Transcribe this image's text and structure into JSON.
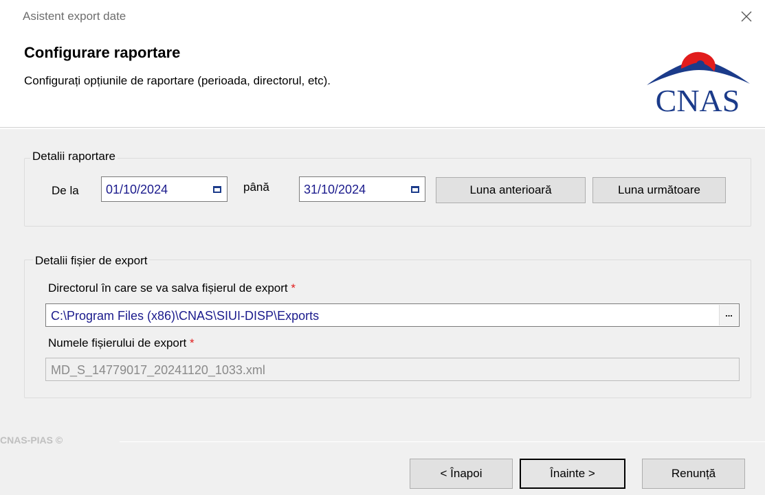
{
  "window": {
    "title": "Asistent export date"
  },
  "header": {
    "title": "Configurare raportare",
    "subtitle": "Configurați opțiunile de raportare (perioada, directorul, etc).",
    "logo_text": "CNAS"
  },
  "report_details": {
    "legend": "Detalii raportare",
    "from_label": "De la",
    "from_value": "01/10/2024",
    "to_label": "până",
    "to_value": "31/10/2024",
    "prev_month_label": "Luna anterioară",
    "next_month_label": "Luna următoare"
  },
  "export_details": {
    "legend": "Detalii fișier de export",
    "directory_label": "Directorul în care se va salva fișierul de export",
    "directory_value": "C:\\Program Files (x86)\\CNAS\\SIUI-DISP\\Exports",
    "browse_label": "...",
    "filename_label": "Numele fișierului de export",
    "filename_value": "MD_S_14779017_20241120_1033.xml",
    "required_mark": "*"
  },
  "footer": {
    "brand": "CNAS-PIAS ©",
    "back_label": "< Înapoi",
    "next_label": "Înainte >",
    "cancel_label": "Renunță"
  },
  "colors": {
    "accent_red": "#e11c1c",
    "logo_blue": "#1b3b8a",
    "value_blue": "#1a1a8c",
    "body_bg": "#f0f0f0"
  },
  "icons": [
    "close-icon",
    "calendar-icon",
    "cnas-logo"
  ]
}
